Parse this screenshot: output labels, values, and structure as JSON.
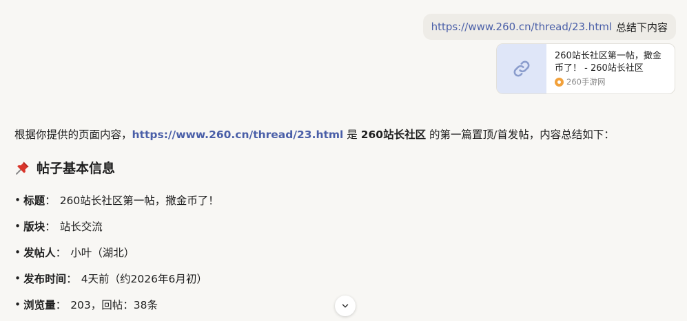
{
  "user_message": {
    "link": "https://www.260.cn/thread/23.html",
    "text": "总结下内容"
  },
  "link_card": {
    "title": "260站长社区第一帖，撒金币了！ - 260站长社区",
    "source": "260手游网",
    "icon": "link-icon"
  },
  "answer": {
    "intro_prefix": "根据你提供的页面内容，",
    "intro_link": "https://www.260.cn/thread/23.html",
    "intro_mid": " 是 ",
    "intro_bold": "260站长社区",
    "intro_suffix": " 的第一篇置顶/首发帖，内容总结如下：",
    "section_title": "帖子基本信息",
    "section_icon": "pushpin-icon",
    "items": [
      {
        "key": "标题",
        "value": "260站长社区第一帖，撒金币了！"
      },
      {
        "key": "版块",
        "value": "站长交流"
      },
      {
        "key": "发帖人",
        "value": "小叶（湖北）"
      },
      {
        "key": "发布时间",
        "value": "4天前（约2026年6月初）"
      },
      {
        "key": "浏览量",
        "value": "203，回帖：38条"
      }
    ]
  },
  "colors": {
    "background": "#f8f7f4",
    "link": "#4a5fa8",
    "user_bubble": "#eeece7",
    "pin": "#d9362b"
  }
}
